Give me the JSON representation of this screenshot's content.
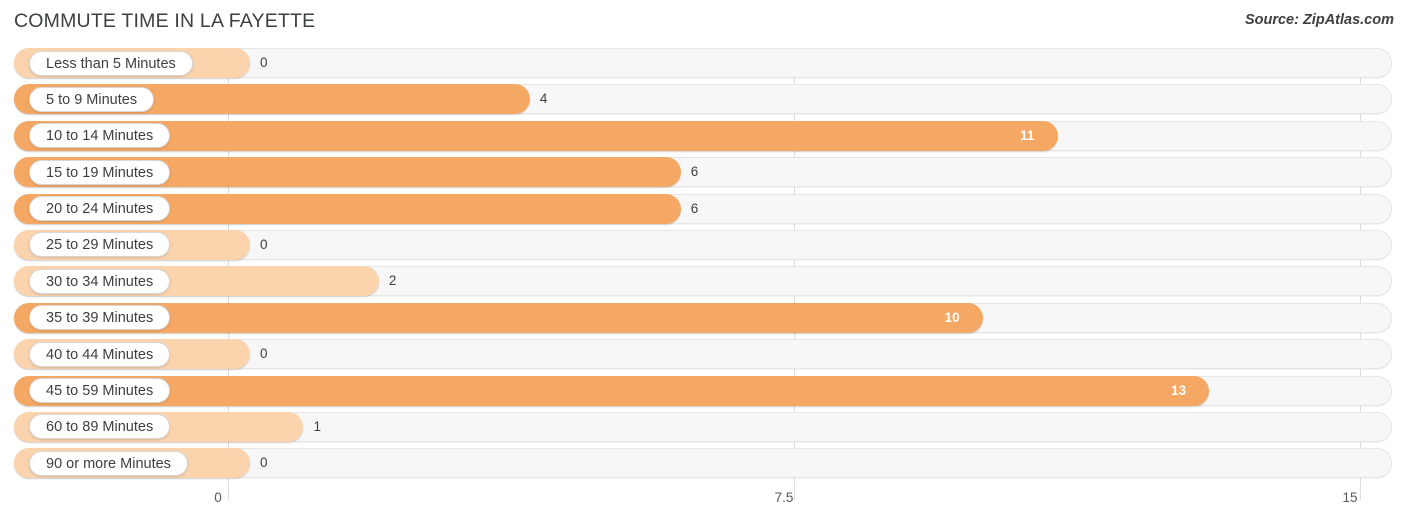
{
  "header": {
    "title": "COMMUTE TIME IN LA FAYETTE",
    "source": "Source: ZipAtlas.com"
  },
  "chart_data": {
    "type": "bar",
    "orientation": "horizontal",
    "title": "COMMUTE TIME IN LA FAYETTE",
    "xlabel": "",
    "ylabel": "",
    "xlim": [
      0,
      15
    ],
    "grid": true,
    "legend": "none",
    "ticks": [
      "0",
      "7.5",
      "15"
    ],
    "tick_values": [
      0,
      7.5,
      15
    ],
    "categories": [
      "Less than 5 Minutes",
      "5 to 9 Minutes",
      "10 to 14 Minutes",
      "15 to 19 Minutes",
      "20 to 24 Minutes",
      "25 to 29 Minutes",
      "30 to 34 Minutes",
      "35 to 39 Minutes",
      "40 to 44 Minutes",
      "45 to 59 Minutes",
      "60 to 89 Minutes",
      "90 or more Minutes"
    ],
    "values": [
      0,
      4,
      11,
      6,
      6,
      0,
      2,
      10,
      0,
      13,
      1,
      0
    ],
    "value_labels": [
      "0",
      "4",
      "11",
      "6",
      "6",
      "0",
      "2",
      "10",
      "0",
      "13",
      "1",
      "0"
    ],
    "colors": {
      "bar": "#f5a863",
      "bar_light": "#fbd3ac",
      "track": "#f7f7f7",
      "gridline": "#dcdcdc",
      "label_text": "#3c4043",
      "inside_label_text": "#ffffff"
    }
  }
}
